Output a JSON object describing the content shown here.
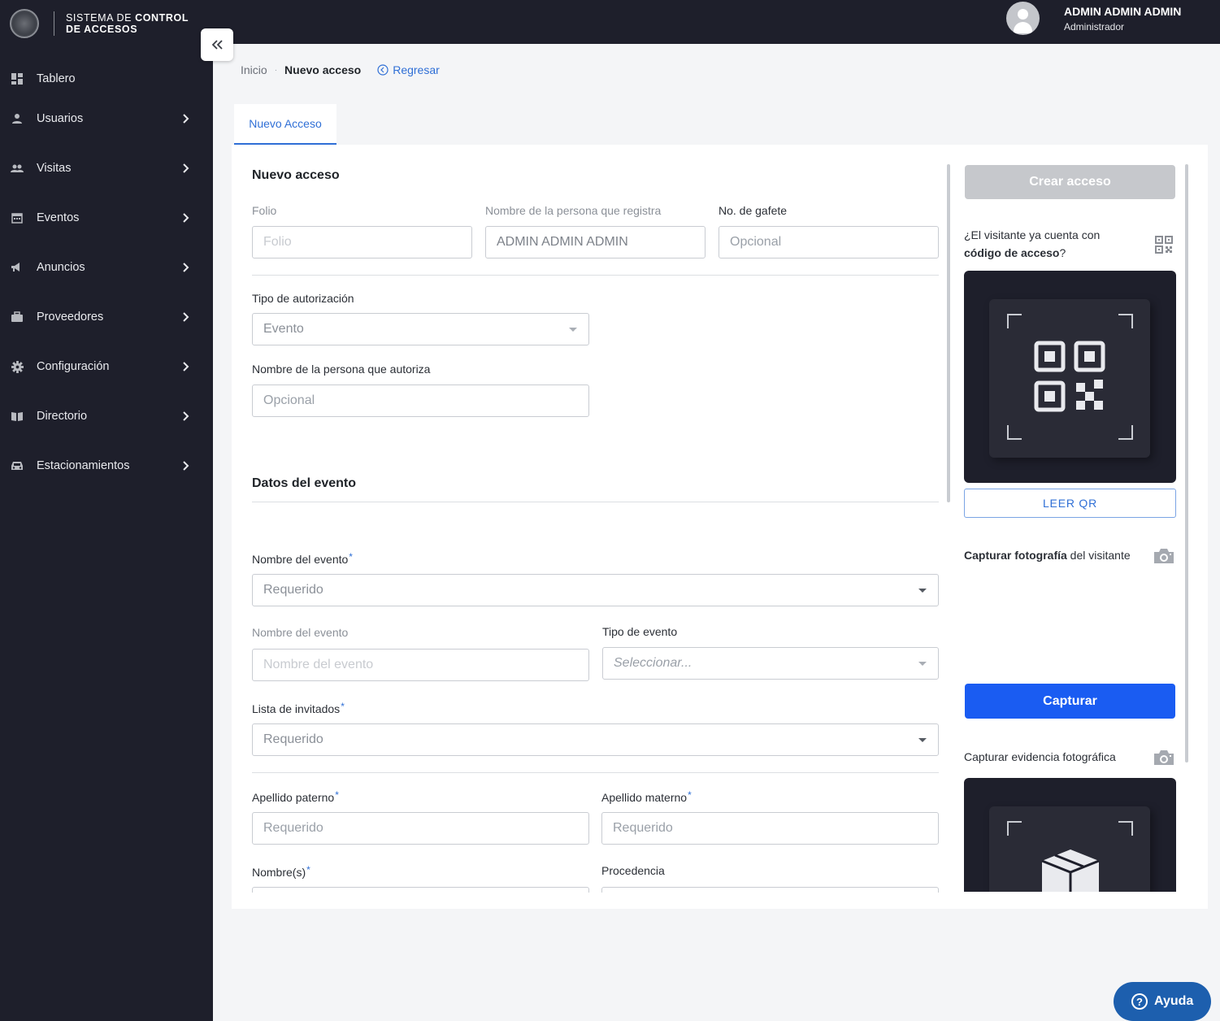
{
  "app": {
    "title_line1_prefix": "SISTEMA DE ",
    "title_line1_bold": "CONTROL",
    "title_line2": "DE ACCESOS"
  },
  "user": {
    "name": "ADMIN ADMIN ADMIN",
    "role": "Administrador"
  },
  "sidebar": {
    "items": [
      {
        "label": "Tablero",
        "icon": "dashboard-icon"
      },
      {
        "label": "Usuarios",
        "icon": "user-icon"
      },
      {
        "label": "Visitas",
        "icon": "group-icon"
      },
      {
        "label": "Eventos",
        "icon": "calendar-icon"
      },
      {
        "label": "Anuncios",
        "icon": "megaphone-icon"
      },
      {
        "label": "Proveedores",
        "icon": "briefcase-icon"
      },
      {
        "label": "Configuración",
        "icon": "gear-icon"
      },
      {
        "label": "Directorio",
        "icon": "book-icon"
      },
      {
        "label": "Estacionamientos",
        "icon": "car-icon"
      }
    ]
  },
  "breadcrumb": {
    "home": "Inicio",
    "separator": "·",
    "current": "Nuevo acceso",
    "back": "Regresar"
  },
  "tabs": [
    {
      "label": "Nuevo Acceso"
    }
  ],
  "form": {
    "section1_title": "Nuevo acceso",
    "folio_label": "Folio",
    "folio_placeholder": "Folio",
    "registra_label": "Nombre de la persona que registra",
    "registra_value": "ADMIN ADMIN ADMIN",
    "gafete_label": "No. de gafete",
    "gafete_placeholder": "Opcional",
    "tipo_aut_label": "Tipo de autorización",
    "tipo_aut_value": "Evento",
    "autoriza_label": "Nombre de la persona que autoriza",
    "autoriza_placeholder": "Opcional",
    "section2_title": "Datos del evento",
    "evento_select_label": "Nombre del evento",
    "evento_select_placeholder": "Requerido",
    "evento_name_label": "Nombre del evento",
    "evento_name_placeholder": "Nombre del evento",
    "tipo_evento_label": "Tipo de evento",
    "tipo_evento_placeholder": "Seleccionar...",
    "invitados_label": "Lista de invitados",
    "invitados_placeholder": "Requerido",
    "paterno_label": "Apellido paterno",
    "paterno_placeholder": "Requerido",
    "materno_label": "Apellido materno",
    "materno_placeholder": "Requerido",
    "nombres_label": "Nombre(s)",
    "procedencia_label": "Procedencia",
    "required_mark": "*"
  },
  "panel": {
    "create_button": "Crear acceso",
    "qr_question_pre": "¿El visitante ya cuenta con ",
    "qr_question_bold": "código de acceso",
    "qr_question_post": "?",
    "read_qr_button": "LEER QR",
    "photo_bold": "Capturar fotografía",
    "photo_rest": " del visitante",
    "capture_button": "Capturar",
    "evidence_label": "Capturar evidencia fotográfica"
  },
  "help": {
    "label": "Ayuda"
  },
  "colors": {
    "sidebar": "#1e1f2b",
    "accent": "#2f6fd6",
    "primary_button": "#1a5cf2",
    "help_button": "#1d5fae"
  }
}
